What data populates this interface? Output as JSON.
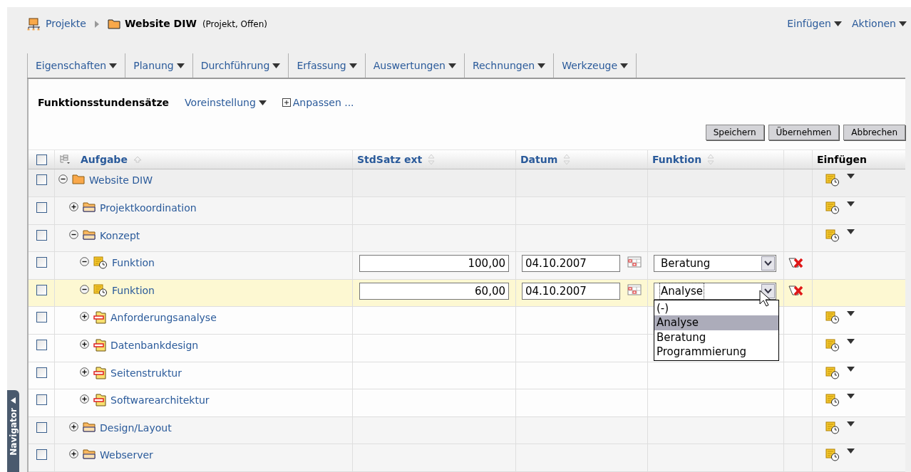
{
  "breadcrumb": {
    "root": "Projekte",
    "title": "Website DIW",
    "meta": "(Projekt, Offen)"
  },
  "top_actions": [
    {
      "label": "Einfügen"
    },
    {
      "label": "Aktionen"
    }
  ],
  "tabs": [
    {
      "label": "Eigenschaften"
    },
    {
      "label": "Planung"
    },
    {
      "label": "Durchführung"
    },
    {
      "label": "Erfassung"
    },
    {
      "label": "Auswertungen"
    },
    {
      "label": "Rechnungen"
    },
    {
      "label": "Werkzeuge"
    }
  ],
  "view": {
    "title": "Funktionsstundensätze",
    "preset": "Voreinstellung",
    "customize": "Anpassen ..."
  },
  "buttons": [
    "Speichern",
    "Übernehmen",
    "Abbrechen"
  ],
  "table": {
    "all_checked": false,
    "columns": [
      {
        "label": "Aufgabe",
        "sortable": true,
        "sorted": true
      },
      {
        "label": "StdSatz ext",
        "sortable": true,
        "sorted": false
      },
      {
        "label": "Datum",
        "sortable": true,
        "sorted": false
      },
      {
        "label": "Funktion",
        "sortable": true,
        "sorted": false
      },
      {
        "label": "Einfügen",
        "sortable": false
      }
    ],
    "rows": [
      {
        "label": "Website DIW",
        "kind": "project",
        "expanded": true,
        "checked": false,
        "selected": false,
        "children": [
          {
            "label": "Projektkoordination",
            "kind": "phase",
            "expanded": false,
            "checked": false,
            "selected": false
          },
          {
            "label": "Konzept",
            "kind": "phase",
            "expanded": true,
            "checked": false,
            "selected": false,
            "children": [
              {
                "label": "Funktion",
                "kind": "function",
                "expanded": true,
                "checked": false,
                "selected": false,
                "rate": "100,00",
                "date": "04.10.2007",
                "function": {
                  "value": "Beratung",
                  "expanded": false
                }
              },
              {
                "label": "Funktion",
                "kind": "function",
                "expanded": true,
                "checked": false,
                "selected": true,
                "rate": "60,00",
                "date": "04.10.2007",
                "function": {
                  "value": "Analyse",
                  "expanded": true,
                  "options": [
                    {
                      "label": "(-)",
                      "selected": false
                    },
                    {
                      "label": "Analyse",
                      "selected": true
                    },
                    {
                      "label": "Beratung",
                      "selected": false
                    },
                    {
                      "label": "Programmierung",
                      "selected": false
                    }
                  ]
                }
              },
              {
                "label": "Anforderungsanalyse",
                "kind": "task",
                "expanded": false,
                "checked": false,
                "selected": false
              },
              {
                "label": "Datenbankdesign",
                "kind": "task",
                "expanded": false,
                "checked": false,
                "selected": false
              },
              {
                "label": "Seitenstruktur",
                "kind": "task",
                "expanded": false,
                "checked": false,
                "selected": false
              },
              {
                "label": "Softwarearchitektur",
                "kind": "task",
                "expanded": false,
                "checked": false,
                "selected": false
              }
            ]
          },
          {
            "label": "Design/Layout",
            "kind": "phase",
            "expanded": false,
            "checked": false,
            "selected": false
          },
          {
            "label": "Webserver",
            "kind": "phase",
            "expanded": false,
            "checked": false,
            "selected": false
          }
        ]
      }
    ]
  },
  "navigator": {
    "label": "Navigator"
  }
}
